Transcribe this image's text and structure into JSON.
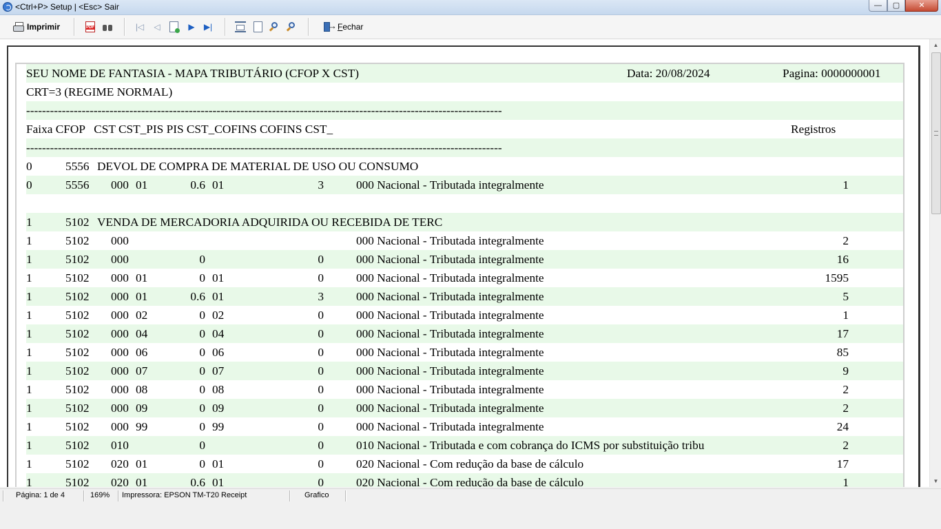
{
  "window": {
    "title": "<Ctrl+P> Setup | <Esc> Sair",
    "buttons": {
      "minimize": "—",
      "maximize": "▢",
      "close": "✕"
    }
  },
  "toolbar": {
    "print_label": "Imprimir",
    "pdf_text": "PDF",
    "close_label_first": "F",
    "close_label_rest": "echar",
    "icons": [
      "printer-icon",
      "pdf-icon",
      "binoculars-icon",
      "first-page-icon",
      "prev-page-icon",
      "open-page-icon",
      "next-page-icon",
      "last-page-icon",
      "page-width-icon",
      "whole-page-icon",
      "zoom-in-icon",
      "zoom-out-icon",
      "exit-icon"
    ]
  },
  "report": {
    "header_title": "SEU NOME DE FANTASIA - MAPA TRIBUTÁRIO (CFOP X CST)",
    "header_date": "Data: 20/08/2024",
    "header_page": "Pagina: 0000000001",
    "crt_line": "CRT=3 (REGIME NORMAL)",
    "divider": "------------------------------------------------------------------------------------------------------------------------",
    "columns_line": "Faixa CFOP   CST CST_PIS PIS CST_COFINS COFINS CST_",
    "columns_registros": "Registros",
    "group1": {
      "faixa": "0",
      "cfop": "5556",
      "desc": "DEVOL DE COMPRA DE MATERIAL DE USO OU CONSUMO"
    },
    "group1_rows": [
      {
        "faixa": "0",
        "cfop": "5556",
        "cst": "000",
        "cst_pis": "01",
        "pis": "0.6",
        "cst_cofins": "01",
        "cofins": "3",
        "cst_desc": "000 Nacional - Tributada integralmente",
        "registros": "1"
      }
    ],
    "group2": {
      "faixa": "1",
      "cfop": "5102",
      "desc": "VENDA DE MERCADORIA ADQUIRIDA OU RECEBIDA DE TERC"
    },
    "group2_rows": [
      {
        "faixa": "1",
        "cfop": "5102",
        "cst": "000",
        "cst_pis": "",
        "pis": "",
        "cst_cofins": "",
        "cofins": "",
        "cst_desc": "000 Nacional - Tributada integralmente",
        "registros": "2"
      },
      {
        "faixa": "1",
        "cfop": "5102",
        "cst": "000",
        "cst_pis": "",
        "pis": "0",
        "cst_cofins": "",
        "cofins": "0",
        "cst_desc": "000 Nacional - Tributada integralmente",
        "registros": "16"
      },
      {
        "faixa": "1",
        "cfop": "5102",
        "cst": "000",
        "cst_pis": "01",
        "pis": "0",
        "cst_cofins": "01",
        "cofins": "0",
        "cst_desc": "000 Nacional - Tributada integralmente",
        "registros": "1595"
      },
      {
        "faixa": "1",
        "cfop": "5102",
        "cst": "000",
        "cst_pis": "01",
        "pis": "0.6",
        "cst_cofins": "01",
        "cofins": "3",
        "cst_desc": "000 Nacional - Tributada integralmente",
        "registros": "5"
      },
      {
        "faixa": "1",
        "cfop": "5102",
        "cst": "000",
        "cst_pis": "02",
        "pis": "0",
        "cst_cofins": "02",
        "cofins": "0",
        "cst_desc": "000 Nacional - Tributada integralmente",
        "registros": "1"
      },
      {
        "faixa": "1",
        "cfop": "5102",
        "cst": "000",
        "cst_pis": "04",
        "pis": "0",
        "cst_cofins": "04",
        "cofins": "0",
        "cst_desc": "000 Nacional - Tributada integralmente",
        "registros": "17"
      },
      {
        "faixa": "1",
        "cfop": "5102",
        "cst": "000",
        "cst_pis": "06",
        "pis": "0",
        "cst_cofins": "06",
        "cofins": "0",
        "cst_desc": "000 Nacional - Tributada integralmente",
        "registros": "85"
      },
      {
        "faixa": "1",
        "cfop": "5102",
        "cst": "000",
        "cst_pis": "07",
        "pis": "0",
        "cst_cofins": "07",
        "cofins": "0",
        "cst_desc": "000 Nacional - Tributada integralmente",
        "registros": "9"
      },
      {
        "faixa": "1",
        "cfop": "5102",
        "cst": "000",
        "cst_pis": "08",
        "pis": "0",
        "cst_cofins": "08",
        "cofins": "0",
        "cst_desc": "000 Nacional - Tributada integralmente",
        "registros": "2"
      },
      {
        "faixa": "1",
        "cfop": "5102",
        "cst": "000",
        "cst_pis": "09",
        "pis": "0",
        "cst_cofins": "09",
        "cofins": "0",
        "cst_desc": "000 Nacional - Tributada integralmente",
        "registros": "2"
      },
      {
        "faixa": "1",
        "cfop": "5102",
        "cst": "000",
        "cst_pis": "99",
        "pis": "0",
        "cst_cofins": "99",
        "cofins": "0",
        "cst_desc": "000 Nacional - Tributada integralmente",
        "registros": "24"
      },
      {
        "faixa": "1",
        "cfop": "5102",
        "cst": "010",
        "cst_pis": "",
        "pis": "0",
        "cst_cofins": "",
        "cofins": "0",
        "cst_desc": "010 Nacional - Tributada e com cobrança do ICMS por substituição tribu",
        "registros": "2"
      },
      {
        "faixa": "1",
        "cfop": "5102",
        "cst": "020",
        "cst_pis": "01",
        "pis": "0",
        "cst_cofins": "01",
        "cofins": "0",
        "cst_desc": "020 Nacional - Com redução da base de cálculo",
        "registros": "17"
      },
      {
        "faixa": "1",
        "cfop": "5102",
        "cst": "020",
        "cst_pis": "01",
        "pis": "0.6",
        "cst_cofins": "01",
        "cofins": "0",
        "cst_desc": "020 Nacional - Com redução da base de cálculo",
        "registros": "1"
      }
    ]
  },
  "statusbar": {
    "page": "Página: 1 de 4",
    "zoom": "169%",
    "printer": "Impressora: EPSON TM-T20 Receipt",
    "mode": "Grafico"
  }
}
